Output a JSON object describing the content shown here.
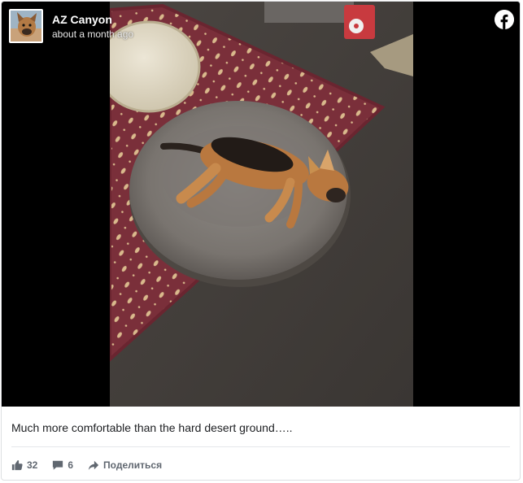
{
  "post": {
    "author": "AZ Canyon",
    "timestamp": "about a month ago",
    "caption": "Much more comfortable than the hard desert ground…..",
    "image": "sleeping-puppy-on-dog-bed-photo",
    "brand_icon": "facebook-icon"
  },
  "actions": {
    "likes": "32",
    "comments": "6",
    "share_label": "Поделиться",
    "like_icon": "thumbs-up-icon",
    "comment_icon": "comment-icon",
    "share_icon": "share-arrow-icon"
  },
  "colors": {
    "text": "#1c1e21",
    "muted": "#606770",
    "media_bg": "#000000"
  }
}
